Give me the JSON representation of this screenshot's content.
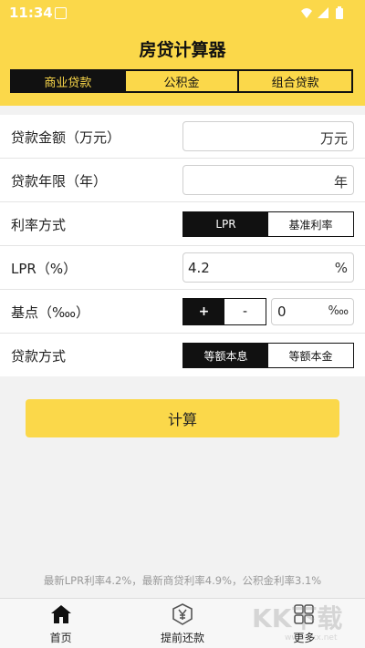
{
  "status_bar": {
    "time": "11:34"
  },
  "header": {
    "title": "房贷计算器"
  },
  "tabs": [
    {
      "label": "商业贷款",
      "active": true
    },
    {
      "label": "公积金",
      "active": false
    },
    {
      "label": "组合贷款",
      "active": false
    }
  ],
  "form": {
    "loan_amount": {
      "label": "贷款金额（万元）",
      "value": "",
      "unit": "万元"
    },
    "loan_years": {
      "label": "贷款年限（年）",
      "value": "",
      "unit": "年"
    },
    "rate_type": {
      "label": "利率方式",
      "options": [
        "LPR",
        "基准利率"
      ],
      "selected": "LPR"
    },
    "lpr": {
      "label": "LPR（%）",
      "value": "4.2",
      "unit": "%"
    },
    "basis_point": {
      "label": "基点（‱）",
      "plus": "+",
      "minus": "-",
      "sign_selected": "+",
      "value": "0",
      "unit": "‱"
    },
    "repay_method": {
      "label": "贷款方式",
      "options": [
        "等额本息",
        "等额本金"
      ],
      "selected": "等额本息"
    }
  },
  "calculate_button": "计算",
  "footer_note": "最新LPR利率4.2%，最新商贷利率4.9%，公积金利率3.1%",
  "bottom_nav": [
    {
      "label": "首页",
      "icon": "home-icon",
      "active": true
    },
    {
      "label": "提前还款",
      "icon": "repay-icon",
      "active": false
    },
    {
      "label": "更多",
      "icon": "grid-icon",
      "active": false
    }
  ],
  "watermark": {
    "text": "KK下载",
    "subtext": "www.kkx.net"
  },
  "colors": {
    "accent": "#fbd84a",
    "dark": "#111111",
    "background": "#f2f2f2"
  }
}
